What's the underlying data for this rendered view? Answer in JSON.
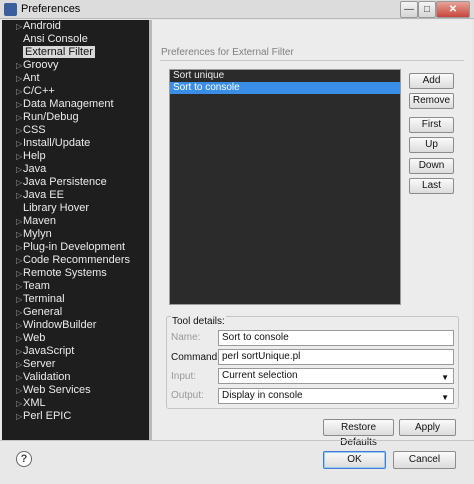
{
  "window": {
    "title": "Preferences",
    "minimize_glyph": "—",
    "maximize_glyph": "□",
    "close_glyph": "✕"
  },
  "sidebar": {
    "items": [
      {
        "label": "Android",
        "expandable": true
      },
      {
        "label": "Ansi Console",
        "expandable": false
      },
      {
        "label": "External Filter",
        "expandable": false,
        "selected": true
      },
      {
        "label": "Groovy",
        "expandable": true
      },
      {
        "label": "Ant",
        "expandable": true
      },
      {
        "label": "C/C++",
        "expandable": true
      },
      {
        "label": "Data Management",
        "expandable": true
      },
      {
        "label": "Run/Debug",
        "expandable": true
      },
      {
        "label": "CSS",
        "expandable": true
      },
      {
        "label": "Install/Update",
        "expandable": true
      },
      {
        "label": "Help",
        "expandable": true
      },
      {
        "label": "Java",
        "expandable": true
      },
      {
        "label": "Java Persistence",
        "expandable": true
      },
      {
        "label": "Java EE",
        "expandable": true
      },
      {
        "label": "Library Hover",
        "expandable": false
      },
      {
        "label": "Maven",
        "expandable": true
      },
      {
        "label": "Mylyn",
        "expandable": true
      },
      {
        "label": "Plug-in Development",
        "expandable": true
      },
      {
        "label": "Code Recommenders",
        "expandable": true
      },
      {
        "label": "Remote Systems",
        "expandable": true
      },
      {
        "label": "Team",
        "expandable": true
      },
      {
        "label": "Terminal",
        "expandable": true
      },
      {
        "label": "General",
        "expandable": true
      },
      {
        "label": "WindowBuilder",
        "expandable": true
      },
      {
        "label": "Web",
        "expandable": true
      },
      {
        "label": "JavaScript",
        "expandable": true
      },
      {
        "label": "Server",
        "expandable": true
      },
      {
        "label": "Validation",
        "expandable": true
      },
      {
        "label": "Web Services",
        "expandable": true
      },
      {
        "label": "XML",
        "expandable": true
      },
      {
        "label": "Perl EPIC",
        "expandable": true
      }
    ]
  },
  "page": {
    "title": "Preferences for External Filter"
  },
  "filters": {
    "items": [
      {
        "label": "Sort unique",
        "selected": false
      },
      {
        "label": "Sort to console",
        "selected": true
      }
    ]
  },
  "buttons": {
    "add": "Add",
    "remove": "Remove",
    "first": "First",
    "up": "Up",
    "down": "Down",
    "last": "Last",
    "restore_defaults": "Restore Defaults",
    "apply": "Apply",
    "ok": "OK",
    "cancel": "Cancel",
    "help": "?"
  },
  "tool_details": {
    "title": "Tool details:",
    "name_label": "Name:",
    "name_value": "Sort to console",
    "command_label": "Command:",
    "command_value": "perl sortUnique.pl",
    "input_label": "Input:",
    "input_value": "Current selection",
    "output_label": "Output:",
    "output_value": "Display in console"
  }
}
